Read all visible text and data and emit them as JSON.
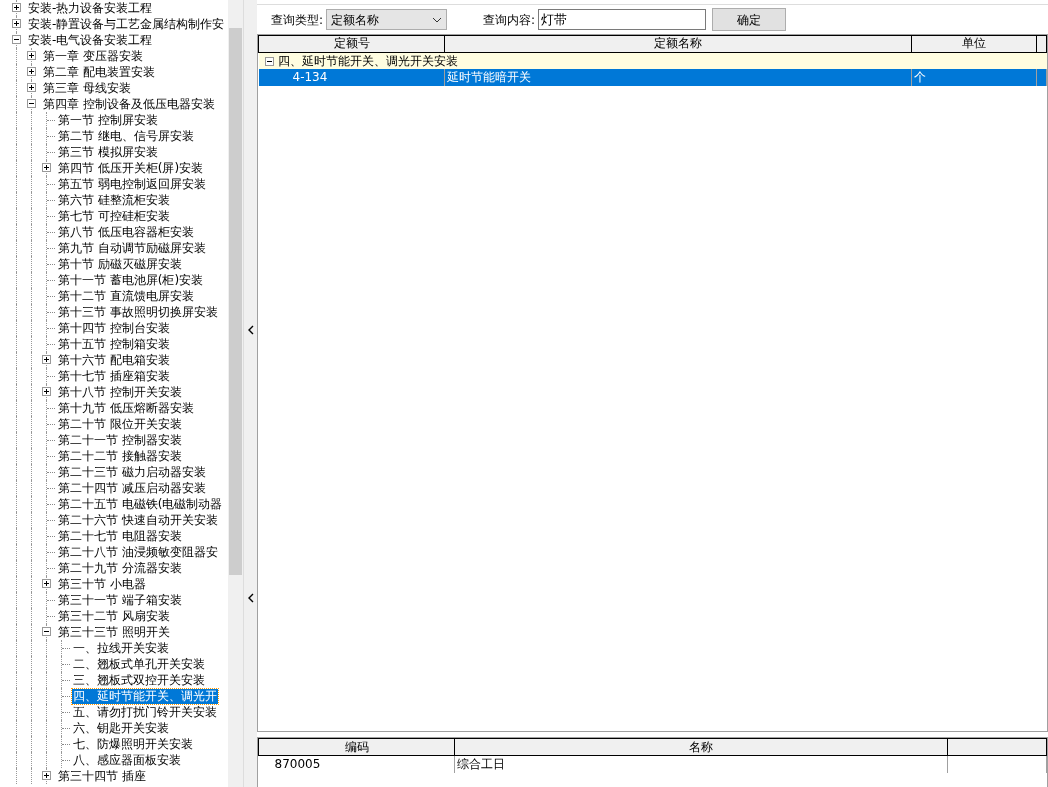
{
  "tree": [
    {
      "label": "安装-热力设备安装工程",
      "expanded": false,
      "selected": false
    },
    {
      "label": "安装-静置设备与工艺金属结构制作安",
      "expanded": false,
      "selected": false
    },
    {
      "label": "安装-电气设备安装工程",
      "expanded": true,
      "selected": false,
      "children": [
        {
          "label": "第一章  变压器安装",
          "expanded": false,
          "selected": false
        },
        {
          "label": "第二章  配电装置安装",
          "expanded": false,
          "selected": false
        },
        {
          "label": "第三章  母线安装",
          "expanded": false,
          "selected": false
        },
        {
          "label": "第四章  控制设备及低压电器安装",
          "expanded": true,
          "selected": false,
          "children": [
            {
              "label": "第一节  控制屏安装",
              "selected": false
            },
            {
              "label": "第二节  继电、信号屏安装",
              "selected": false
            },
            {
              "label": "第三节  模拟屏安装",
              "selected": false
            },
            {
              "label": "第四节  低压开关柜(屏)安装",
              "expanded": false,
              "selected": false
            },
            {
              "label": "第五节  弱电控制返回屏安装",
              "selected": false
            },
            {
              "label": "第六节  硅整流柜安装",
              "selected": false
            },
            {
              "label": "第七节  可控硅柜安装",
              "selected": false
            },
            {
              "label": "第八节  低压电容器柜安装",
              "selected": false
            },
            {
              "label": "第九节  自动调节励磁屏安装",
              "selected": false
            },
            {
              "label": "第十节  励磁灭磁屏安装",
              "selected": false
            },
            {
              "label": "第十一节  蓄电池屏(柜)安装",
              "selected": false
            },
            {
              "label": "第十二节  直流馈电屏安装",
              "selected": false
            },
            {
              "label": "第十三节  事故照明切换屏安装",
              "selected": false
            },
            {
              "label": "第十四节  控制台安装",
              "selected": false
            },
            {
              "label": "第十五节  控制箱安装",
              "selected": false
            },
            {
              "label": "第十六节  配电箱安装",
              "expanded": false,
              "selected": false
            },
            {
              "label": "第十七节  插座箱安装",
              "selected": false
            },
            {
              "label": "第十八节  控制开关安装",
              "expanded": false,
              "selected": false
            },
            {
              "label": "第十九节  低压熔断器安装",
              "selected": false
            },
            {
              "label": "第二十节  限位开关安装",
              "selected": false
            },
            {
              "label": "第二十一节  控制器安装",
              "selected": false
            },
            {
              "label": "第二十二节  接触器安装",
              "selected": false
            },
            {
              "label": "第二十三节  磁力启动器安装",
              "selected": false
            },
            {
              "label": "第二十四节  减压启动器安装",
              "selected": false
            },
            {
              "label": "第二十五节  电磁铁(电磁制动器",
              "selected": false
            },
            {
              "label": "第二十六节  快速自动开关安装",
              "selected": false
            },
            {
              "label": "第二十七节  电阻器安装",
              "selected": false
            },
            {
              "label": "第二十八节  油浸频敏变阻器安",
              "selected": false
            },
            {
              "label": "第二十九节  分流器安装",
              "selected": false
            },
            {
              "label": "第三十节  小电器",
              "expanded": false,
              "selected": false
            },
            {
              "label": "第三十一节  端子箱安装",
              "selected": false
            },
            {
              "label": "第三十二节  风扇安装",
              "selected": false
            },
            {
              "label": "第三十三节  照明开关",
              "expanded": true,
              "selected": false,
              "children": [
                {
                  "label": "一、拉线开关安装",
                  "selected": false
                },
                {
                  "label": "二、翘板式单孔开关安装",
                  "selected": false
                },
                {
                  "label": "三、翘板式双控开关安装",
                  "selected": false
                },
                {
                  "label": "四、延时节能开关、调光开",
                  "selected": true
                },
                {
                  "label": "五、请勿打扰门铃开关安装",
                  "selected": false
                },
                {
                  "label": "六、钥匙开关安装",
                  "selected": false
                },
                {
                  "label": "七、防爆照明开关安装",
                  "selected": false
                },
                {
                  "label": "八、感应器面板安装",
                  "selected": false
                }
              ]
            },
            {
              "label": "第三十四节  插座",
              "expanded": false,
              "selected": false
            }
          ]
        }
      ]
    }
  ],
  "query": {
    "type_label": "查询类型:",
    "type_value": "定额名称",
    "content_label": "查询内容:",
    "content_value": "灯带",
    "confirm": "确定"
  },
  "quota_table": {
    "columns": [
      "定额号",
      "定额名称",
      "单位"
    ],
    "groups": [
      {
        "title": "四、延时节能开关、调光开关安装",
        "expanded": true,
        "rows": [
          {
            "cells": [
              "4-134",
              "延时节能暗开关",
              "个"
            ],
            "selected": true
          }
        ]
      }
    ]
  },
  "resource_table": {
    "columns": [
      "编码",
      "名称"
    ],
    "rows": [
      {
        "cells": [
          "870005",
          "综合工日"
        ],
        "selected": false
      }
    ]
  }
}
